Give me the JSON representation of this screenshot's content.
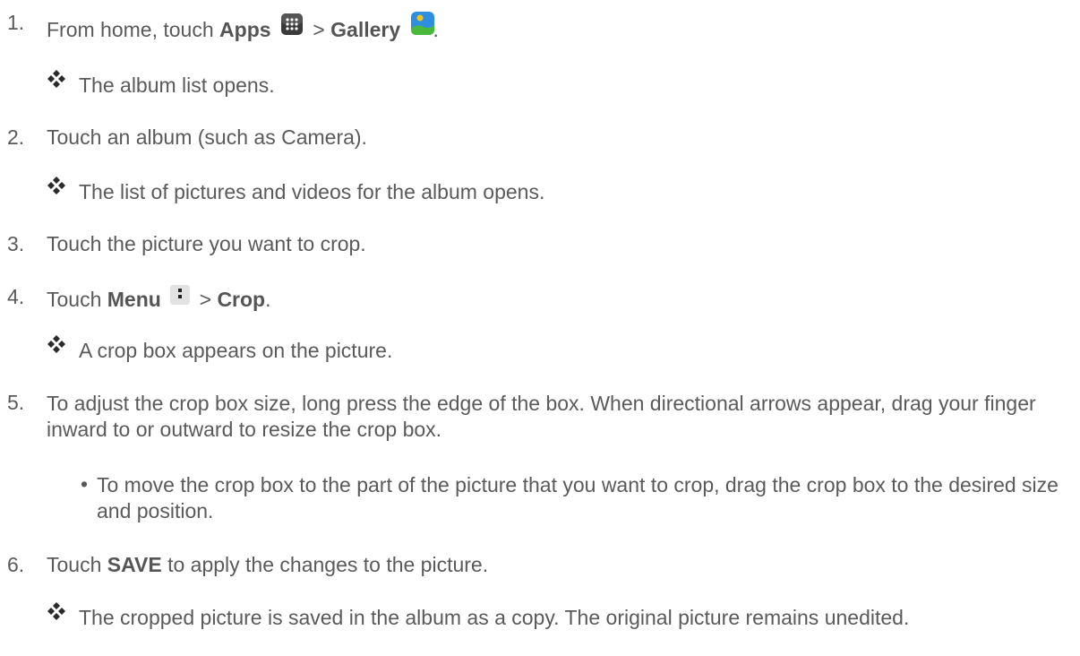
{
  "steps": [
    {
      "num": "1.",
      "pre": "From home, touch ",
      "b1": "Apps",
      "mid": " > ",
      "b2": "Gallery",
      "end": ".",
      "icon1": "apps-grid-icon",
      "icon2": "gallery-icon",
      "result": "The album list opens."
    },
    {
      "num": "2.",
      "text": "Touch an album (such as Camera).",
      "result": "The list of pictures and videos for the album opens."
    },
    {
      "num": "3.",
      "text": "Touch the picture you want to crop."
    },
    {
      "num": "4.",
      "pre": "Touch ",
      "b1": "Menu",
      "mid": " > ",
      "b2": "Crop",
      "end": ".",
      "icon1": "menu-dots-icon",
      "result": "A crop box appears on the picture."
    },
    {
      "num": "5.",
      "text": "To adjust the crop box size, long press the edge of the box. When directional arrows appear, drag your finger inward to or outward to resize the crop box.",
      "bullet": "To move the crop box to the part of the picture that you want to crop, drag the crop box to the desired size and position."
    },
    {
      "num": "6.",
      "pre": "Touch ",
      "b1": "SAVE",
      "post": " to apply the changes to the picture.",
      "result": "The cropped picture is saved in the album as a copy. The original picture remains unedited."
    }
  ],
  "colors": {
    "text": "#5a5a5a",
    "icon_dark": "#222222",
    "gallery_blue": "#2e8fe0",
    "gallery_green": "#49b93c",
    "gallery_sun": "#f6c21c"
  },
  "result_icon": "four-diamond-icon",
  "bullet_glyph": "•"
}
